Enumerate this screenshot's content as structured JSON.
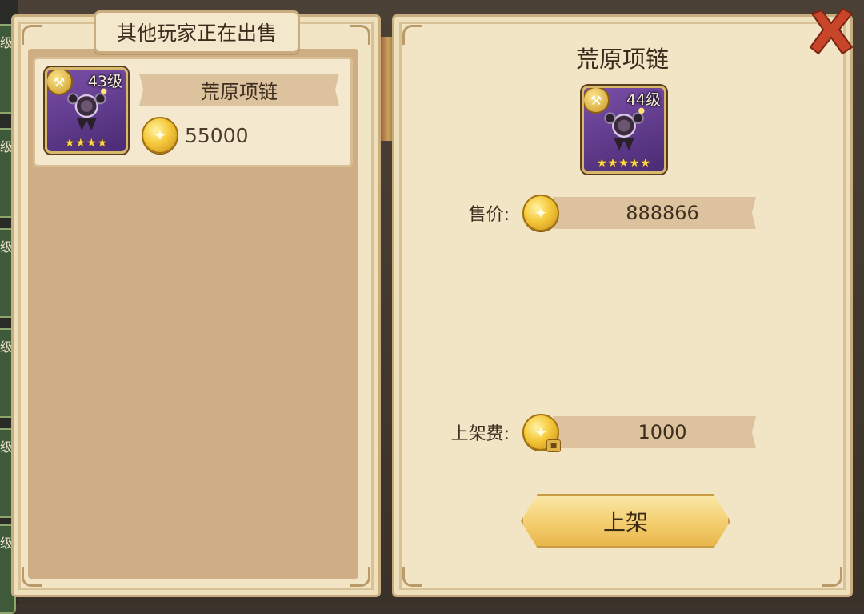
{
  "left_panel": {
    "title": "其他玩家正在出售",
    "listing": {
      "item_name": "荒原项链",
      "level": "43级",
      "stars": "★★★★",
      "price": "55000"
    }
  },
  "right_panel": {
    "item_name": "荒原项链",
    "level": "44级",
    "stars": "★★★★★",
    "price_label": "售价:",
    "price_value": "888866",
    "fee_label": "上架费:",
    "fee_value": "1000",
    "list_button_label": "上架"
  },
  "background": {
    "side_badge_text": "级"
  },
  "icons": {
    "close": "close-icon",
    "coin": "gold-coin-icon",
    "axe_badge": "axe-badge-icon",
    "lock": "lock-icon"
  },
  "colors": {
    "parchment": "#f1e5c6",
    "inner_panel": "#cfae86",
    "button_gold": "#f3cd6e",
    "close_red": "#c9452a",
    "item_purple": "#5a3a8a"
  }
}
